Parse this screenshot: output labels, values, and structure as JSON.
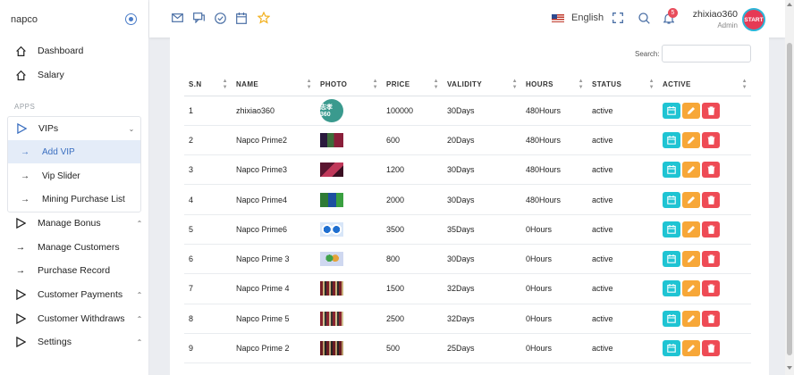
{
  "brand": "napco",
  "nav": {
    "dashboard": "Dashboard",
    "salary": "Salary",
    "apps_label": "APPS",
    "vips": "VIPs",
    "add_vip": "Add VIP",
    "vip_slider": "Vip Slider",
    "mining": "Mining Purchase List",
    "manage_bonus": "Manage Bonus",
    "manage_customers": "Manage Customers",
    "purchase_record": "Purchase Record",
    "customer_payments": "Customer Payments",
    "customer_withdraws": "Customer Withdraws",
    "settings": "Settings"
  },
  "topbar": {
    "language": "English",
    "notification_count": "5",
    "username": "zhixiao360",
    "role": "Admin",
    "avatar_text": "START"
  },
  "search": {
    "label": "Search:",
    "value": ""
  },
  "table": {
    "headers": [
      "S.N",
      "NAME",
      "PHOTO",
      "PRICE",
      "VALIDITY",
      "HOURS",
      "STATUS",
      "ACTIVE"
    ],
    "rows": [
      {
        "sn": "1",
        "name": "zhixiao360",
        "price": "100000",
        "validity": "30Days",
        "hours": "480Hours",
        "status": "active",
        "photo_text": "志孝 360"
      },
      {
        "sn": "2",
        "name": "Napco Prime2",
        "price": "600",
        "validity": "20Days",
        "hours": "480Hours",
        "status": "active"
      },
      {
        "sn": "3",
        "name": "Napco Prime3",
        "price": "1200",
        "validity": "30Days",
        "hours": "480Hours",
        "status": "active"
      },
      {
        "sn": "4",
        "name": "Napco Prime4",
        "price": "2000",
        "validity": "30Days",
        "hours": "480Hours",
        "status": "active"
      },
      {
        "sn": "5",
        "name": "Napco Prime6",
        "price": "3500",
        "validity": "35Days",
        "hours": "0Hours",
        "status": "active"
      },
      {
        "sn": "6",
        "name": "Napco Prime 3",
        "price": "800",
        "validity": "30Days",
        "hours": "0Hours",
        "status": "active"
      },
      {
        "sn": "7",
        "name": "Napco Prime 4",
        "price": "1500",
        "validity": "32Days",
        "hours": "0Hours",
        "status": "active"
      },
      {
        "sn": "8",
        "name": "Napco Prime 5",
        "price": "2500",
        "validity": "32Days",
        "hours": "0Hours",
        "status": "active"
      },
      {
        "sn": "9",
        "name": "Napco Prime 2",
        "price": "500",
        "validity": "25Days",
        "hours": "0Hours",
        "status": "active"
      }
    ]
  },
  "colors": {
    "accent": "#3b6fc0",
    "view_button": "#1fc4d3",
    "edit_button": "#f7a738",
    "delete_button": "#ee4b55"
  }
}
